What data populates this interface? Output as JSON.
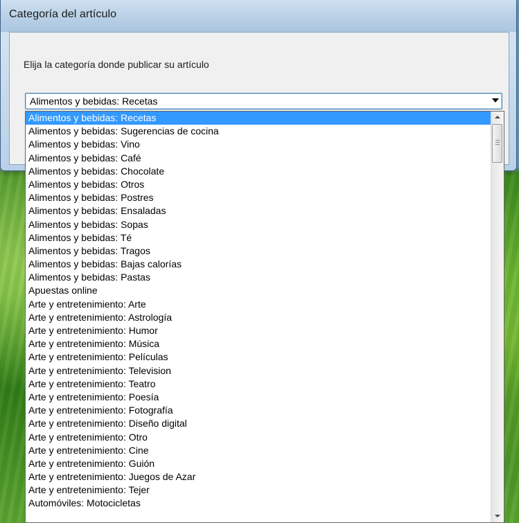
{
  "window": {
    "title": "Categoría del artículo",
    "prompt": "Elija la categoría donde publicar su artículo"
  },
  "combo": {
    "selected_value": "Alimentos y bebidas: Recetas"
  },
  "dropdown": {
    "selected_index": 0,
    "items": [
      "Alimentos y bebidas: Recetas",
      "Alimentos y bebidas: Sugerencias de cocina",
      "Alimentos y bebidas: Vino",
      "Alimentos y bebidas: Café",
      "Alimentos y bebidas: Chocolate",
      "Alimentos y bebidas: Otros",
      "Alimentos y bebidas: Postres",
      "Alimentos y bebidas: Ensaladas",
      "Alimentos y bebidas: Sopas",
      "Alimentos y bebidas: Té",
      "Alimentos y bebidas: Tragos",
      "Alimentos y bebidas: Bajas calorías",
      "Alimentos y bebidas: Pastas",
      "Apuestas online",
      "Arte y entretenimiento: Arte",
      "Arte y entretenimiento: Astrología",
      "Arte y entretenimiento: Humor",
      "Arte y entretenimiento: Música",
      "Arte y entretenimiento: Películas",
      "Arte y entretenimiento: Television",
      "Arte y entretenimiento: Teatro",
      "Arte y entretenimiento: Poesía",
      "Arte y entretenimiento: Fotografía",
      "Arte y entretenimiento: Diseño digital",
      "Arte y entretenimiento: Otro",
      "Arte y entretenimiento: Cine",
      "Arte y entretenimiento: Guión",
      "Arte y entretenimiento: Juegos de Azar",
      "Arte y entretenimiento: Tejer",
      "Automóviles: Motocicletas"
    ]
  },
  "icons": {
    "combo_arrow": "chevron-down-icon",
    "scroll_up": "arrow-up-icon",
    "scroll_down": "arrow-down-icon"
  },
  "colors": {
    "selection": "#3399ff",
    "combo_border": "#3c7fb1"
  }
}
